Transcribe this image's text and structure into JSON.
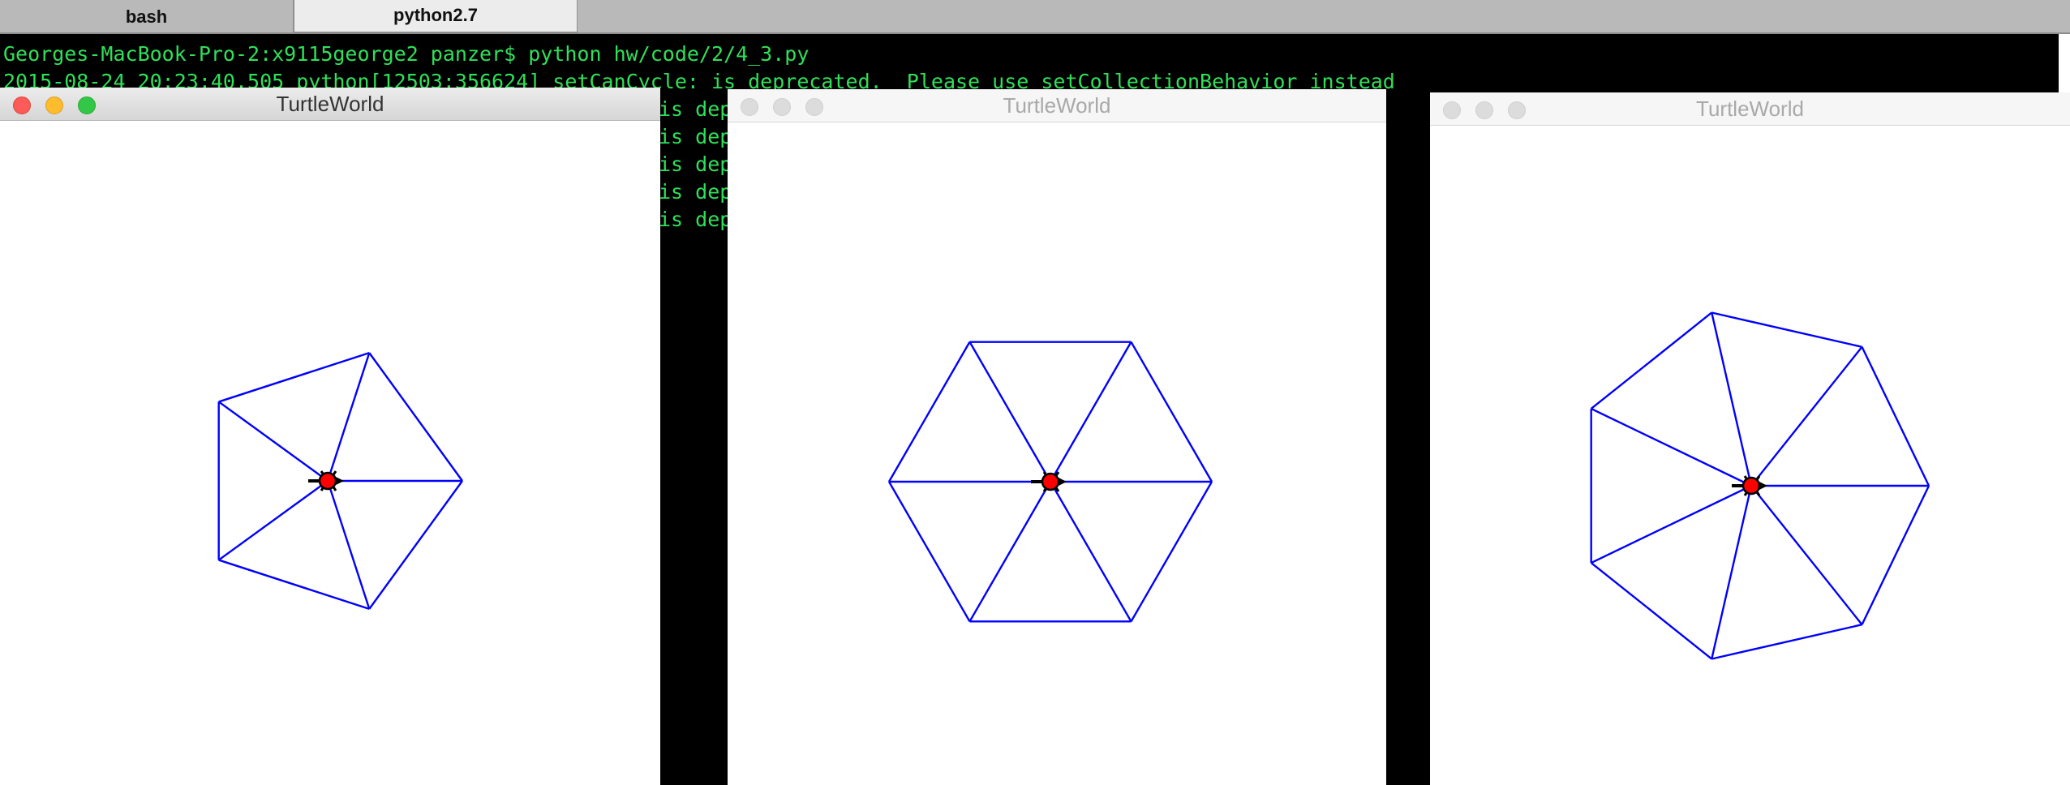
{
  "tabs": [
    {
      "label": "bash",
      "active": false
    },
    {
      "label": "python2.7",
      "active": true
    }
  ],
  "terminal": {
    "lines": [
      "Georges-MacBook-Pro-2:x9115george2 panzer$ python hw/code/2/4_3.py",
      "2015-08-24 20:23:40.505 python[12503:356624] setCanCycle: is deprecated.  Please use setCollectionBehavior instead",
      "is dep",
      "is dep",
      "is dep",
      "is dep",
      "is dep"
    ],
    "text_color": "#2ee05a",
    "background": "#000000"
  },
  "windows": [
    {
      "title": "TurtleWorld",
      "active": true,
      "polygon_sides": 5
    },
    {
      "title": "TurtleWorld",
      "active": false,
      "polygon_sides": 6
    },
    {
      "title": "TurtleWorld",
      "active": false,
      "polygon_sides": 7
    }
  ],
  "colors": {
    "line": "#0000ff",
    "turtle": "#ff0000",
    "turtle_outline": "#000000",
    "close": "#fc5b57",
    "minimize": "#fdbc2e",
    "zoom": "#33c748"
  }
}
